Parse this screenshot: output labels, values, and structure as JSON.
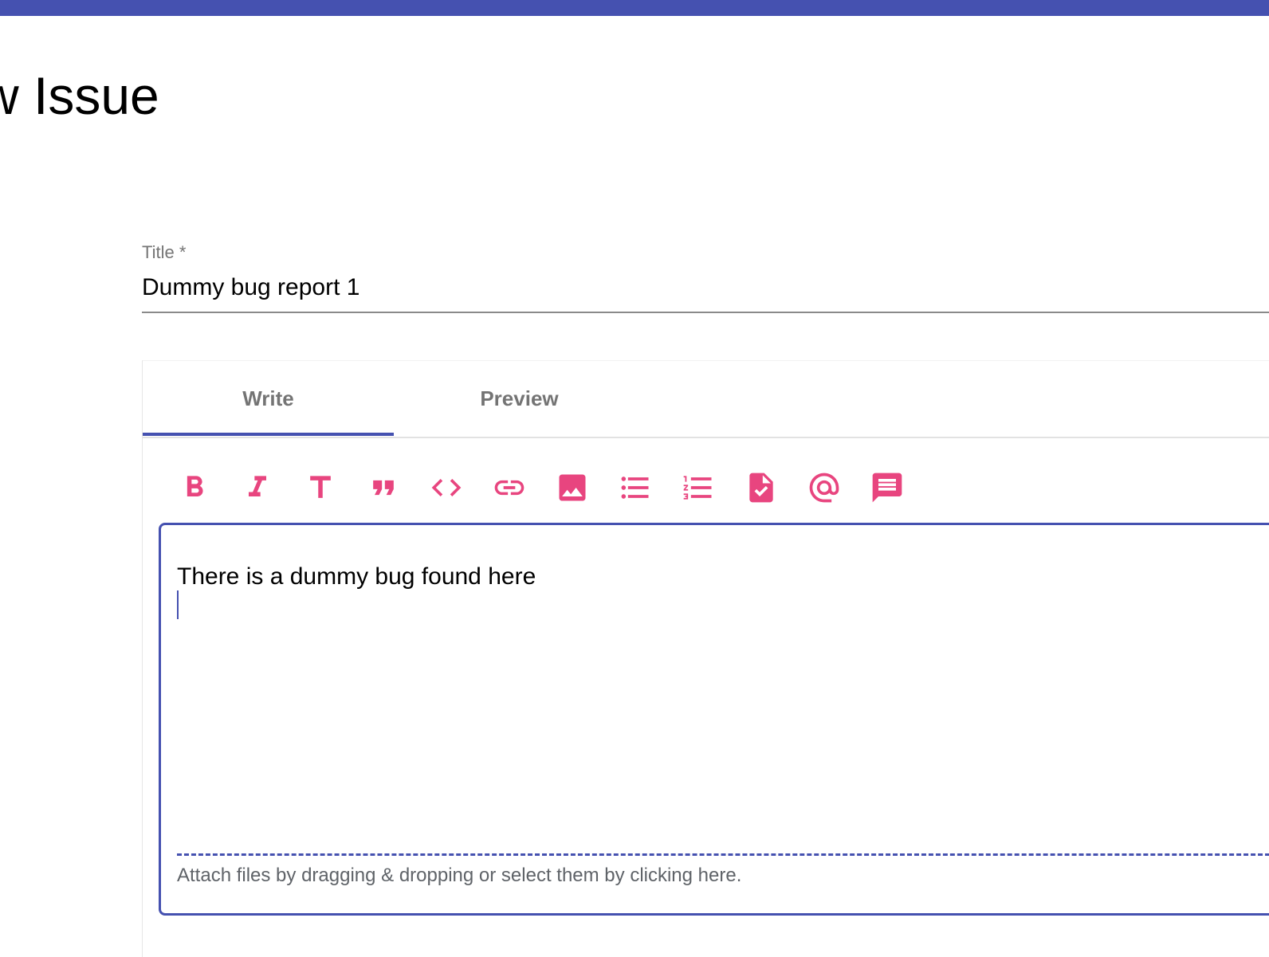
{
  "header": {
    "accent_color": "#4551b0"
  },
  "page": {
    "title": "w Issue"
  },
  "title_field": {
    "label": "Title *",
    "value": "Dummy bug report 1"
  },
  "editor": {
    "tabs": [
      {
        "label": "Write",
        "active": true
      },
      {
        "label": "Preview",
        "active": false
      }
    ],
    "toolbar": {
      "icon_color": "#e8457f",
      "items": [
        "bold-icon",
        "italic-icon",
        "heading-icon",
        "quote-icon",
        "code-icon",
        "link-icon",
        "image-icon",
        "bulleted-list-icon",
        "numbered-list-icon",
        "task-list-icon",
        "mention-icon",
        "saved-reply-icon"
      ]
    },
    "body": "There is a dummy bug found here",
    "attach_text": "Attach files by dragging & dropping or select them by clicking here."
  }
}
